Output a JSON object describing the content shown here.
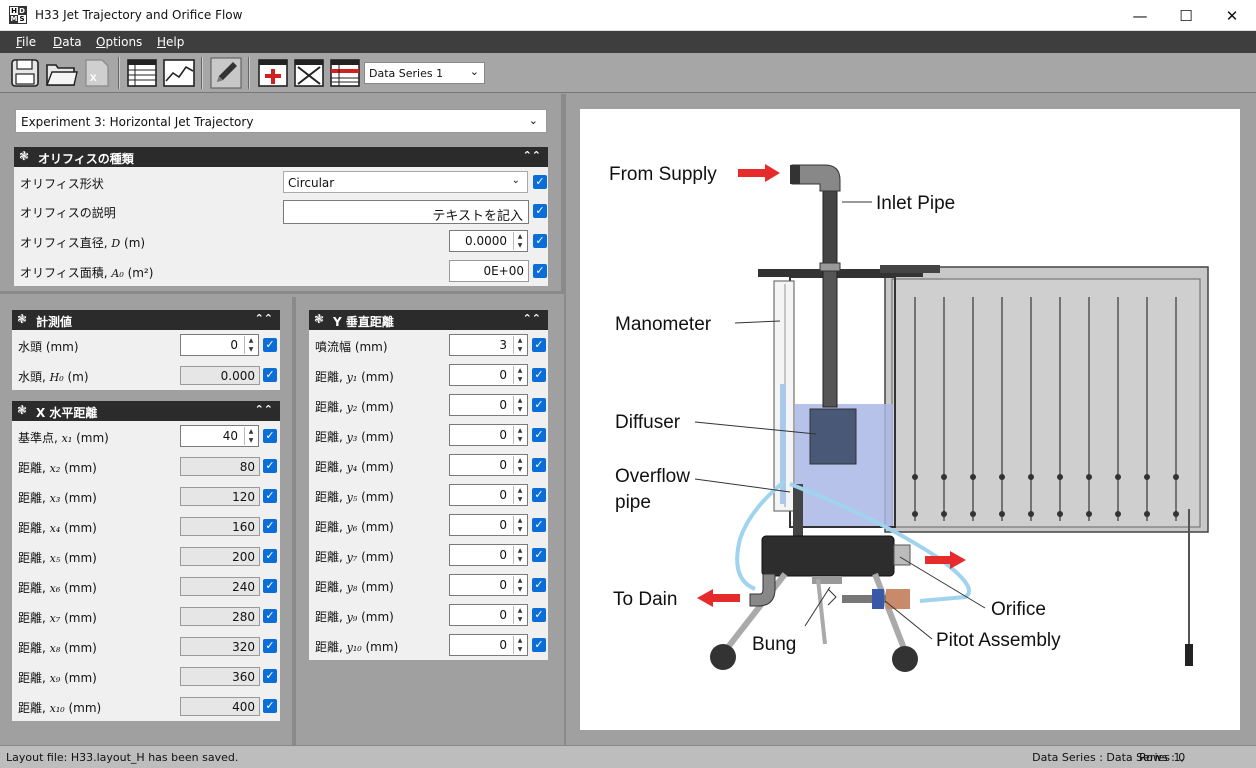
{
  "window": {
    "title": "H33 Jet Trajectory and Orifice Flow",
    "logo": [
      "H",
      "D",
      "M",
      "S"
    ],
    "minimize": "—",
    "maximize": "☐",
    "close": "✕"
  },
  "menu": [
    {
      "label": "File",
      "u": "F",
      "rest": "ile"
    },
    {
      "label": "Data",
      "u": "D",
      "rest": "ata"
    },
    {
      "label": "Options",
      "u": "O",
      "rest": "ptions"
    },
    {
      "label": "Help",
      "u": "H",
      "rest": "elp"
    }
  ],
  "toolbar": {
    "series_select": "Data Series 1",
    "icons": [
      "save-icon",
      "open-folder-icon",
      "excel-export-icon",
      "table-view-icon",
      "chart-view-icon",
      "edit-pen-icon",
      "add-row-icon",
      "delete-row-icon",
      "table-settings-icon"
    ]
  },
  "experiment": {
    "selected": "Experiment 3: Horizontal Jet Trajectory"
  },
  "orifice": {
    "header": "オリフィスの種類",
    "shape_label": "オリフィス形状",
    "shape_value": "Circular",
    "desc_label": "オリフィスの説明",
    "desc_value": "テキストを記入",
    "diam_label": "オリフィス直径, ",
    "diam_sym": "D",
    "diam_unit": " (m)",
    "diam_value": "0.0000",
    "area_label": "オリフィス面積, ",
    "area_sym": "A₀",
    "area_unit": " (m²)",
    "area_value": "0E+00"
  },
  "measure": {
    "header": "計測値",
    "head_label": "水頭  (mm)",
    "head_value": "0",
    "h0_label": "水頭, ",
    "h0_sym": "H₀",
    "h0_unit": " (m)",
    "h0_value": "0.000"
  },
  "xdist": {
    "header": "X 水平距離",
    "rows": [
      {
        "label": "基準点, ",
        "sym": "x₁",
        "unit": " (mm)",
        "value": "40"
      },
      {
        "label": "距離, ",
        "sym": "x₂",
        "unit": " (mm)",
        "value": "80"
      },
      {
        "label": "距離, ",
        "sym": "x₃",
        "unit": " (mm)",
        "value": "120"
      },
      {
        "label": "距離, ",
        "sym": "x₄",
        "unit": " (mm)",
        "value": "160"
      },
      {
        "label": "距離, ",
        "sym": "x₅",
        "unit": " (mm)",
        "value": "200"
      },
      {
        "label": "距離, ",
        "sym": "x₆",
        "unit": " (mm)",
        "value": "240"
      },
      {
        "label": "距離, ",
        "sym": "x₇",
        "unit": " (mm)",
        "value": "280"
      },
      {
        "label": "距離, ",
        "sym": "x₈",
        "unit": " (mm)",
        "value": "320"
      },
      {
        "label": "距離, ",
        "sym": "x₉",
        "unit": " (mm)",
        "value": "360"
      },
      {
        "label": "距離, ",
        "sym": "x₁₀",
        "unit": " (mm)",
        "value": "400"
      }
    ]
  },
  "ydist": {
    "header": "Y 垂直距離",
    "rows": [
      {
        "label": "噴流幅  (mm)",
        "sym": "",
        "unit": "",
        "value": "3"
      },
      {
        "label": "距離, ",
        "sym": "y₁",
        "unit": " (mm)",
        "value": "0"
      },
      {
        "label": "距離, ",
        "sym": "y₂",
        "unit": " (mm)",
        "value": "0"
      },
      {
        "label": "距離, ",
        "sym": "y₃",
        "unit": " (mm)",
        "value": "0"
      },
      {
        "label": "距離, ",
        "sym": "y₄",
        "unit": " (mm)",
        "value": "0"
      },
      {
        "label": "距離, ",
        "sym": "y₅",
        "unit": " (mm)",
        "value": "0"
      },
      {
        "label": "距離, ",
        "sym": "y₆",
        "unit": " (mm)",
        "value": "0"
      },
      {
        "label": "距離, ",
        "sym": "y₇",
        "unit": " (mm)",
        "value": "0"
      },
      {
        "label": "距離, ",
        "sym": "y₈",
        "unit": " (mm)",
        "value": "0"
      },
      {
        "label": "距離, ",
        "sym": "y₉",
        "unit": " (mm)",
        "value": "0"
      },
      {
        "label": "距離, ",
        "sym": "y₁₀",
        "unit": " (mm)",
        "value": "0"
      }
    ]
  },
  "diagram": {
    "from_supply": "From Supply",
    "inlet_pipe": "Inlet Pipe",
    "manometer": "Manometer",
    "diffuser": "Diffuser",
    "overflow1": "Overflow",
    "overflow2": "pipe",
    "to_drain": "To Dain",
    "bung": "Bung",
    "orifice": "Orifice",
    "pitot": "Pitot Assembly"
  },
  "status": {
    "left": "Layout file: H33.layout_H has been saved.",
    "right": "Data Series : Data Series 1,",
    "rows": "Rows : 0"
  }
}
